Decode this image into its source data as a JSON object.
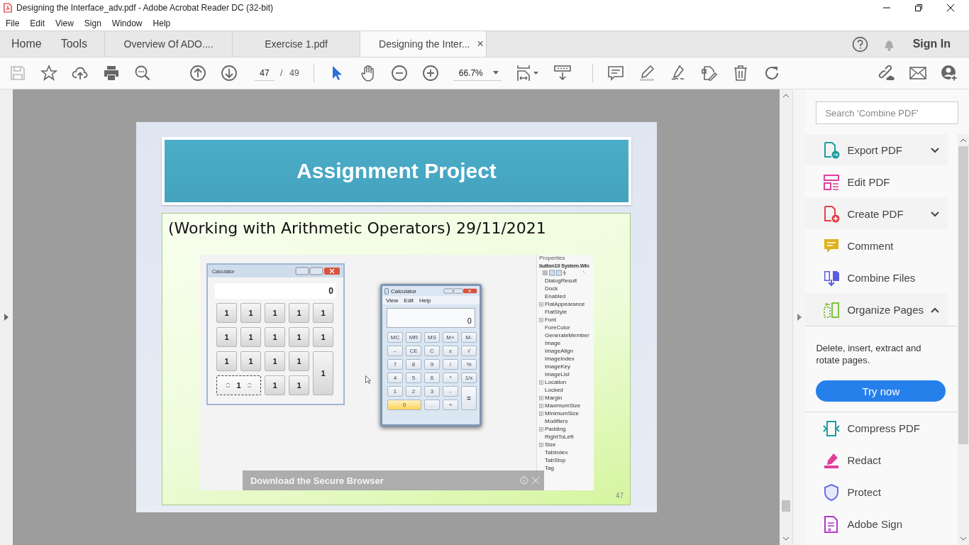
{
  "window": {
    "title": "Designing the Interface_adv.pdf - Adobe Acrobat Reader DC (32-bit)"
  },
  "menu": [
    "File",
    "Edit",
    "View",
    "Sign",
    "Window",
    "Help"
  ],
  "tabs": [
    {
      "label": "Home",
      "kind": "nav",
      "selected": false
    },
    {
      "label": "Tools",
      "kind": "nav",
      "selected": false
    },
    {
      "label": "Overview Of ADO....",
      "kind": "document",
      "selected": false
    },
    {
      "label": "Exercise 1.pdf",
      "kind": "document",
      "selected": false
    },
    {
      "label": "Designing the Inter...",
      "kind": "document",
      "selected": true,
      "close": "×"
    }
  ],
  "sign_in": "Sign In",
  "toolbar": {
    "page": "47",
    "separator": "/",
    "total": "49",
    "zoom": "66.7%",
    "pointer_selected": true,
    "hand_selected": false
  },
  "document": {
    "banner": "Assignment Project",
    "subtitle": "(Working with Arithmetic Operators) 29/11/2021",
    "page_number": "47",
    "screenshot": {
      "left_calculator": {
        "title": "Calculator",
        "display": "0",
        "keys": [
          {
            "label": "1",
            "kind": "key",
            "selected": false
          },
          {
            "label": "1",
            "kind": "key",
            "selected": false
          },
          {
            "label": "1",
            "kind": "key",
            "selected": false
          },
          {
            "label": "1",
            "kind": "key",
            "selected": false
          },
          {
            "label": "1",
            "kind": "key",
            "selected": false
          },
          {
            "label": "1",
            "kind": "key",
            "selected": false
          },
          {
            "label": "1",
            "kind": "key",
            "selected": false
          },
          {
            "label": "1",
            "kind": "key",
            "selected": false
          },
          {
            "label": "1",
            "kind": "key",
            "selected": false
          },
          {
            "label": "1",
            "kind": "key",
            "selected": false
          },
          {
            "label": "1",
            "kind": "key",
            "selected": false
          },
          {
            "label": "1",
            "kind": "key",
            "selected": false
          },
          {
            "label": "1",
            "kind": "key",
            "selected": false
          },
          {
            "label": "1",
            "kind": "key",
            "selected": false
          },
          {
            "label": "1",
            "kind": "tall",
            "selected": false
          },
          {
            "label": "1",
            "kind": "wide",
            "selected": true
          },
          {
            "label": "1",
            "kind": "key",
            "selected": false
          },
          {
            "label": "1",
            "kind": "key",
            "selected": false
          }
        ]
      },
      "right_calculator": {
        "title": "Calculator",
        "menu": [
          "View",
          "Edit",
          "Help"
        ],
        "display": "0",
        "keys": [
          {
            "label": "MC",
            "kind": "key"
          },
          {
            "label": "MR",
            "kind": "key"
          },
          {
            "label": "MS",
            "kind": "key"
          },
          {
            "label": "M+",
            "kind": "key"
          },
          {
            "label": "M-",
            "kind": "key"
          },
          {
            "label": "←",
            "kind": "key"
          },
          {
            "label": "CE",
            "kind": "key"
          },
          {
            "label": "C",
            "kind": "key"
          },
          {
            "label": "±",
            "kind": "key"
          },
          {
            "label": "√",
            "kind": "key"
          },
          {
            "label": "7",
            "kind": "key"
          },
          {
            "label": "8",
            "kind": "key"
          },
          {
            "label": "9",
            "kind": "key"
          },
          {
            "label": "/",
            "kind": "key"
          },
          {
            "label": "%",
            "kind": "key"
          },
          {
            "label": "4",
            "kind": "key"
          },
          {
            "label": "5",
            "kind": "key"
          },
          {
            "label": "6",
            "kind": "key"
          },
          {
            "label": "*",
            "kind": "key"
          },
          {
            "label": "1/x",
            "kind": "key"
          },
          {
            "label": "1",
            "kind": "key"
          },
          {
            "label": "2",
            "kind": "key"
          },
          {
            "label": "3",
            "kind": "key"
          },
          {
            "label": "-",
            "kind": "key"
          },
          {
            "label": "=",
            "kind": "tall"
          },
          {
            "label": "0",
            "kind": "lit"
          },
          {
            "label": ".",
            "kind": "key"
          },
          {
            "label": "+",
            "kind": "key"
          }
        ]
      },
      "properties": {
        "title": "Properties",
        "object": "button10 System.Win",
        "items": [
          {
            "label": "DialogResult",
            "expandable": false
          },
          {
            "label": "Dock",
            "expandable": false
          },
          {
            "label": "Enabled",
            "expandable": false
          },
          {
            "label": "FlatAppearance",
            "expandable": true
          },
          {
            "label": "FlatStyle",
            "expandable": false
          },
          {
            "label": "Font",
            "expandable": true
          },
          {
            "label": "ForeColor",
            "expandable": false
          },
          {
            "label": "GenerateMember",
            "expandable": false
          },
          {
            "label": "Image",
            "expandable": false
          },
          {
            "label": "ImageAlign",
            "expandable": false
          },
          {
            "label": "ImageIndex",
            "expandable": false
          },
          {
            "label": "ImageKey",
            "expandable": false
          },
          {
            "label": "ImageList",
            "expandable": false
          },
          {
            "label": "Location",
            "expandable": true
          },
          {
            "label": "Locked",
            "expandable": false
          },
          {
            "label": "Margin",
            "expandable": true
          },
          {
            "label": "MaximumSize",
            "expandable": true
          },
          {
            "label": "MinimumSize",
            "expandable": true
          },
          {
            "label": "Modifiers",
            "expandable": false
          },
          {
            "label": "Padding",
            "expandable": true
          },
          {
            "label": "RightToLeft",
            "expandable": false
          },
          {
            "label": "Size",
            "expandable": true
          },
          {
            "label": "TabIndex",
            "expandable": false
          },
          {
            "label": "TabStop",
            "expandable": false
          },
          {
            "label": "Tag",
            "expandable": false
          }
        ]
      },
      "overlay": {
        "text": "Download the Secure Browser"
      }
    }
  },
  "panel": {
    "search_placeholder": "Search 'Combine PDF'",
    "tools": [
      {
        "label": "Export PDF",
        "kind": "export",
        "color": "#1e9ea0",
        "expanded": false
      },
      {
        "label": "Edit PDF",
        "kind": "edit",
        "color": "#e0409a"
      },
      {
        "label": "Create PDF",
        "kind": "create",
        "color": "#e0434b",
        "expanded": false
      },
      {
        "label": "Comment",
        "kind": "comment",
        "color": "#e0b21c"
      },
      {
        "label": "Combine Files",
        "kind": "combine",
        "color": "#5b5be0"
      },
      {
        "label": "Organize Pages",
        "kind": "organize",
        "color": "#7dc242",
        "expanded": true
      }
    ],
    "description": "Delete, insert, extract and rotate pages.",
    "button": "Try now",
    "more_tools": [
      {
        "label": "Compress PDF",
        "kind": "compress",
        "color": "#1e9ea0"
      },
      {
        "label": "Redact",
        "kind": "redact",
        "color": "#e0409a"
      },
      {
        "label": "Protect",
        "kind": "protect",
        "color": "#6c6cf0"
      },
      {
        "label": "Adobe Sign",
        "kind": "sign",
        "color": "#b03cc8"
      }
    ]
  }
}
